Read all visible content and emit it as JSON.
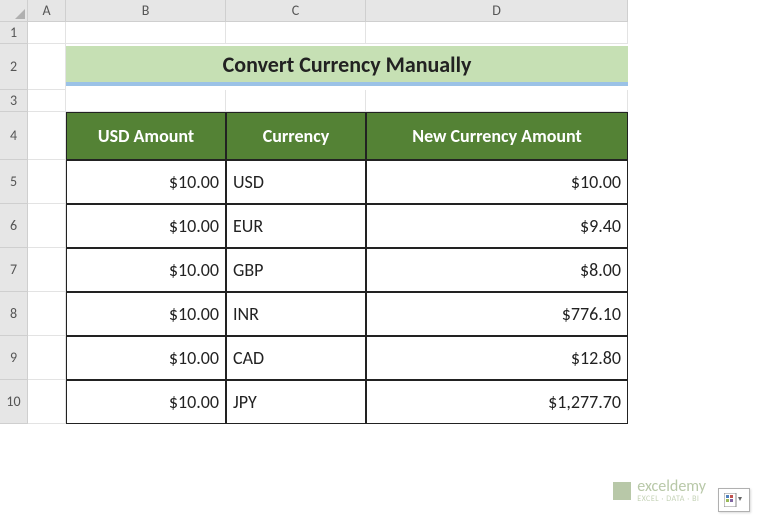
{
  "columns": [
    "A",
    "B",
    "C",
    "D"
  ],
  "rows": [
    "1",
    "2",
    "3",
    "4",
    "5",
    "6",
    "7",
    "8",
    "9",
    "10"
  ],
  "title": "Convert Currency Manually",
  "headers": {
    "usd": "USD Amount",
    "currency": "Currency",
    "new": "New Currency Amount"
  },
  "table": [
    {
      "usd": "$10.00",
      "cur": "USD",
      "new": "$10.00"
    },
    {
      "usd": "$10.00",
      "cur": "EUR",
      "new": "$9.40"
    },
    {
      "usd": "$10.00",
      "cur": "GBP",
      "new": "$8.00"
    },
    {
      "usd": "$10.00",
      "cur": "INR",
      "new": "$776.10"
    },
    {
      "usd": "$10.00",
      "cur": "CAD",
      "new": "$12.80"
    },
    {
      "usd": "$10.00",
      "cur": "JPY",
      "new": "$1,277.70"
    }
  ],
  "watermark": {
    "brand": "exceldemy",
    "tag": "EXCEL · DATA · BI"
  },
  "chart_data": {
    "type": "table",
    "title": "Convert Currency Manually",
    "columns": [
      "USD Amount",
      "Currency",
      "New Currency Amount"
    ],
    "rows": [
      [
        "$10.00",
        "USD",
        "$10.00"
      ],
      [
        "$10.00",
        "EUR",
        "$9.40"
      ],
      [
        "$10.00",
        "GBP",
        "$8.00"
      ],
      [
        "$10.00",
        "INR",
        "$776.10"
      ],
      [
        "$10.00",
        "CAD",
        "$12.80"
      ],
      [
        "$10.00",
        "JPY",
        "$1,277.70"
      ]
    ]
  }
}
